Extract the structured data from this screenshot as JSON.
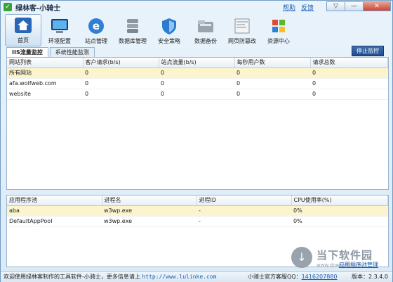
{
  "app": {
    "title": "绿林客-小骑士"
  },
  "title_links": {
    "help": "帮助",
    "feedback": "反馈"
  },
  "window_controls": {
    "menu": "▽",
    "minimize": "—",
    "close": "✕"
  },
  "toolbar": {
    "items": [
      {
        "label": "首页",
        "icon": "home-icon",
        "active": true
      },
      {
        "label": "环境配置",
        "icon": "monitor-icon"
      },
      {
        "label": "站点管理",
        "icon": "ie-icon"
      },
      {
        "label": "数据库管理",
        "icon": "database-icon"
      },
      {
        "label": "安全策略",
        "icon": "shield-icon"
      },
      {
        "label": "数据备份",
        "icon": "folder-icon"
      },
      {
        "label": "网页防篡改",
        "icon": "webpage-icon"
      },
      {
        "label": "资源中心",
        "icon": "windows-icon"
      }
    ]
  },
  "tabs": [
    {
      "label": "IIS流量监控",
      "active": true
    },
    {
      "label": "系统性能监测",
      "active": false
    }
  ],
  "stop_button": "停止监控",
  "site_table": {
    "columns": [
      "网站列表",
      "客户请求(b/s)",
      "站点流量(b/s)",
      "每秒用户数",
      "请求总数"
    ],
    "rows": [
      {
        "cells": [
          "所有网站",
          "0",
          "0",
          "0",
          "0"
        ],
        "selected": true
      },
      {
        "cells": [
          "afa.wolfweb.com",
          "0",
          "0",
          "0",
          "0"
        ],
        "selected": false
      },
      {
        "cells": [
          "website",
          "0",
          "0",
          "0",
          "0"
        ],
        "selected": false
      }
    ]
  },
  "pool_table": {
    "columns": [
      "应用程序池",
      "进程名",
      "进程ID",
      "CPU使用率(%)"
    ],
    "rows": [
      {
        "cells": [
          "aba",
          "w3wp.exe",
          "-",
          "0%"
        ],
        "selected": true
      },
      {
        "cells": [
          "DefaultAppPool",
          "w3wp.exe",
          "-",
          "0%"
        ],
        "selected": false
      }
    ]
  },
  "watermark": {
    "main": "当下软件园",
    "sub": "www.downxia.com",
    "glyph": "↓"
  },
  "pool_manage_link": "应用程序池管理",
  "status": {
    "left_text": "欢迎使用绿林客制作的工具软件-小骑士，更多信息请上",
    "url": "http://www.lulinke.com",
    "qq_label": "小骑士官方客服QQ：",
    "qq": "1416207880",
    "version": "版本：2.3.4.0"
  },
  "colors": {
    "accent": "#1f4b8a",
    "selected_row": "#fcf4cd",
    "link": "#1a5fb4"
  }
}
